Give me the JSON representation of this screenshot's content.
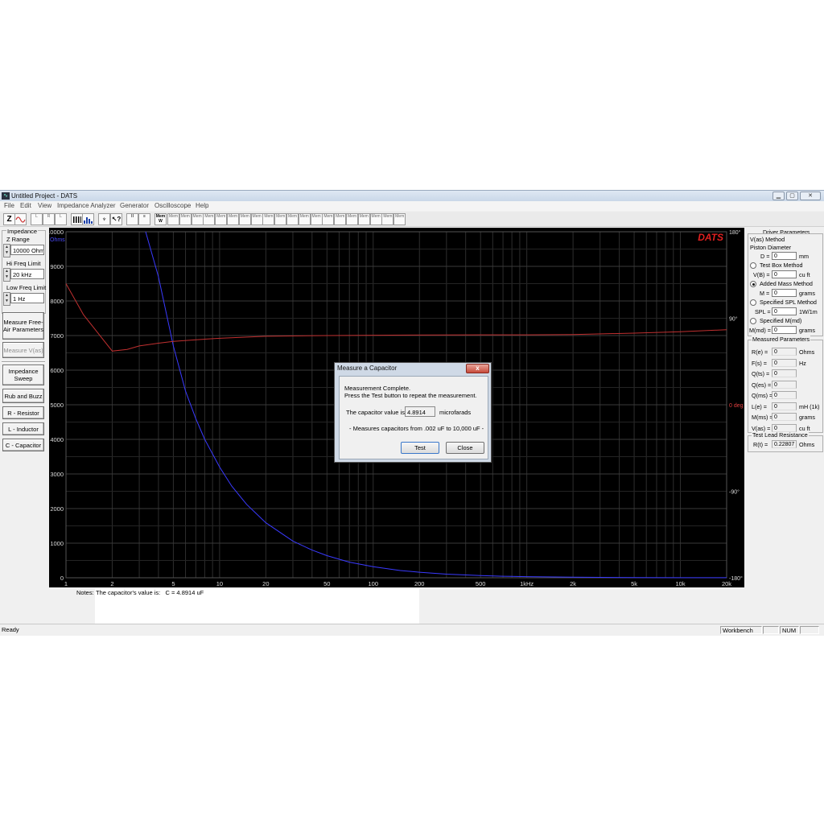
{
  "window": {
    "title": "Untitled Project - DATS",
    "app_icon": "waveform-icon",
    "min_label": "▁",
    "max_label": "▢",
    "close_label": "✕"
  },
  "menu": [
    "File",
    "Edit",
    "View",
    "Impedance Analyzer",
    "Generator",
    "Oscilloscope",
    "Help"
  ],
  "toolbar": {
    "z_label": "Z",
    "first_group": [
      "L",
      "R",
      "L",
      "C"
    ],
    "mem_label": "Mem",
    "mem_sub": "W",
    "slot_count_label": "Mem"
  },
  "left_panel": {
    "impedance_label": "Impedance",
    "z_range_label": "Z Range",
    "z_range_value": "10000 Ohms",
    "hi_freq_label": "Hi Freq Limit",
    "hi_freq_value": "20 kHz",
    "low_freq_label": "Low Freq Limit",
    "low_freq_value": "1 Hz",
    "buttons": {
      "measure_free_air": "Measure Free-Air Parameters",
      "measure_vas": "Measure V(as)",
      "impedance_sweep": "Impedance Sweep",
      "rub_buzz": "Rub and Buzz",
      "r_resistor": "R - Resistor",
      "l_inductor": "L - Inductor",
      "c_capacitor": "C - Capacitor"
    }
  },
  "chart_data": {
    "type": "line",
    "x_scale": "log",
    "xlim": [
      1,
      20000
    ],
    "ylim": [
      0,
      10000
    ],
    "ylabel": "Ohms",
    "x_ticks": [
      {
        "v": 1,
        "label": "1"
      },
      {
        "v": 2,
        "label": "2"
      },
      {
        "v": 5,
        "label": "5"
      },
      {
        "v": 10,
        "label": "10"
      },
      {
        "v": 20,
        "label": "20"
      },
      {
        "v": 50,
        "label": "50"
      },
      {
        "v": 100,
        "label": "100"
      },
      {
        "v": 200,
        "label": "200"
      },
      {
        "v": 500,
        "label": "500"
      },
      {
        "v": 1000,
        "label": "1kHz"
      },
      {
        "v": 2000,
        "label": "2k"
      },
      {
        "v": 5000,
        "label": "5k"
      },
      {
        "v": 10000,
        "label": "10k"
      },
      {
        "v": 20000,
        "label": "20k"
      }
    ],
    "y_ticks": [
      0,
      1000,
      2000,
      3000,
      4000,
      5000,
      6000,
      7000,
      8000,
      9000,
      10000
    ],
    "phase_ticks": [
      {
        "deg": 180,
        "label": "180°"
      },
      {
        "deg": 90,
        "label": "90°"
      },
      {
        "deg": 0,
        "label": "0 deg"
      },
      {
        "deg": -90,
        "label": "-90°"
      },
      {
        "deg": -180,
        "label": "-180°"
      }
    ],
    "phase_lim": [
      -180,
      180
    ],
    "brand": "DATS",
    "series": [
      {
        "id": "impedance",
        "color": "#3a3aff",
        "points": [
          [
            3.3,
            10000
          ],
          [
            4,
            8700
          ],
          [
            5,
            6700
          ],
          [
            6,
            5400
          ],
          [
            7,
            4600
          ],
          [
            8,
            4000
          ],
          [
            10,
            3200
          ],
          [
            12,
            2650
          ],
          [
            15,
            2120
          ],
          [
            20,
            1590
          ],
          [
            30,
            1060
          ],
          [
            40,
            800
          ],
          [
            50,
            640
          ],
          [
            70,
            450
          ],
          [
            100,
            320
          ],
          [
            150,
            210
          ],
          [
            200,
            160
          ],
          [
            300,
            105
          ],
          [
            500,
            65
          ],
          [
            700,
            45
          ],
          [
            1000,
            32
          ],
          [
            2000,
            16
          ],
          [
            5000,
            6
          ],
          [
            10000,
            3
          ],
          [
            20000,
            2
          ]
        ]
      },
      {
        "id": "phase",
        "color": "#c03030",
        "points": [
          [
            1,
            8500
          ],
          [
            1.3,
            7600
          ],
          [
            2,
            6550
          ],
          [
            2.5,
            6600
          ],
          [
            3,
            6700
          ],
          [
            4,
            6780
          ],
          [
            5,
            6830
          ],
          [
            7,
            6880
          ],
          [
            10,
            6920
          ],
          [
            20,
            6980
          ],
          [
            50,
            7000
          ],
          [
            100,
            7010
          ],
          [
            500,
            7020
          ],
          [
            1000,
            7020
          ],
          [
            2000,
            7030
          ],
          [
            5000,
            7070
          ],
          [
            10000,
            7110
          ],
          [
            20000,
            7170
          ]
        ]
      }
    ]
  },
  "right_panel": {
    "driver_params_label": "Driver Parameters",
    "vas_method_label": "V(as) Method",
    "piston_label": "Piston Diameter",
    "d_label": "D =",
    "d_value": "0",
    "d_unit": "mm",
    "test_box_label": "Test Box Method",
    "vb_label": "V(B) =",
    "vb_value": "0",
    "vb_unit": "cu ft",
    "added_mass_label": "Added Mass Method",
    "m_label": "M =",
    "m_value": "0",
    "m_unit": "grams",
    "spl_method_label": "Specified SPL Method",
    "spl_label": "SPL =",
    "spl_value": "0",
    "spl_unit": "1W/1m",
    "mmd_method_label": "Specified M(md)",
    "mmd_label": "M(md) =",
    "mmd_value": "0",
    "mmd_unit": "grams",
    "measured_label": "Measured Parameters",
    "measured": [
      {
        "label": "R(e) =",
        "value": "0",
        "unit": "Ohms"
      },
      {
        "label": "F(s) =",
        "value": "0",
        "unit": "Hz"
      },
      {
        "label": "Q(ts) =",
        "value": "0",
        "unit": ""
      },
      {
        "label": "Q(es) =",
        "value": "0",
        "unit": ""
      },
      {
        "label": "Q(ms) =",
        "value": "0",
        "unit": ""
      },
      {
        "label": "L(e) =",
        "value": "0",
        "unit": "mH (1k)"
      },
      {
        "label": "M(ms) =",
        "value": "0",
        "unit": "grams"
      },
      {
        "label": "V(as) =",
        "value": "0",
        "unit": "cu ft"
      }
    ],
    "test_lead_label": "Test Lead Resistance",
    "rt_label": "R(t) =",
    "rt_value": "0.22807",
    "rt_unit": "Ohms"
  },
  "notes": {
    "label": "Notes:",
    "text": "The capacitor's value is:   C = 4.8914 uF"
  },
  "status": {
    "ready": "Ready",
    "workbench": "Workbench",
    "num": "NUM"
  },
  "dialog": {
    "title": "Measure a Capacitor",
    "close_label": "x",
    "line1": "Measurement Complete.",
    "line2": "Press the Test button to repeat the measurement.",
    "value_label": "The capacitor value is:",
    "value": "4.8914",
    "unit": "microfarads",
    "range_note": "- Measures capacitors from .002 uF to 10,000 uF -",
    "test_button": "Test",
    "close_button": "Close"
  }
}
